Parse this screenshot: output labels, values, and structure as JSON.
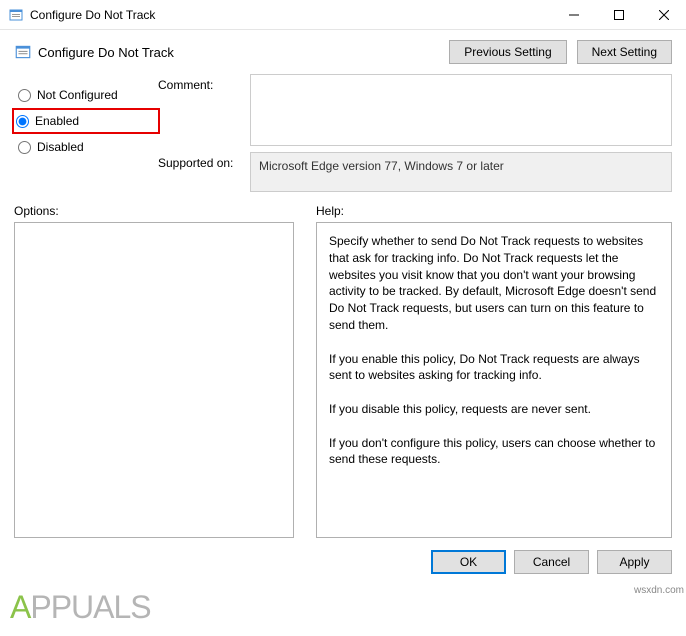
{
  "window": {
    "title": "Configure Do Not Track"
  },
  "header": {
    "title": "Configure Do Not Track",
    "prev_button": "Previous Setting",
    "next_button": "Next Setting"
  },
  "radios": {
    "not_configured": "Not Configured",
    "enabled": "Enabled",
    "disabled": "Disabled",
    "selected": "enabled"
  },
  "fields": {
    "comment_label": "Comment:",
    "comment_value": "",
    "supported_label": "Supported on:",
    "supported_value": "Microsoft Edge version 77, Windows 7 or later"
  },
  "panes": {
    "options_label": "Options:",
    "help_label": "Help:",
    "help_text": "Specify whether to send Do Not Track requests to websites that ask for tracking info. Do Not Track requests let the websites you visit know that you don't want your browsing activity to be tracked. By default, Microsoft Edge doesn't send Do Not Track requests, but users can turn on this feature to send them.\n\nIf you enable this policy, Do Not Track requests are always sent to websites asking for tracking info.\n\nIf you disable this policy, requests are never sent.\n\nIf you don't configure this policy, users can choose whether to send these requests."
  },
  "footer": {
    "ok": "OK",
    "cancel": "Cancel",
    "apply": "Apply"
  },
  "watermark": {
    "text_a": "A",
    "text_rest": "PPUALS",
    "source": "wsxdn.com"
  }
}
